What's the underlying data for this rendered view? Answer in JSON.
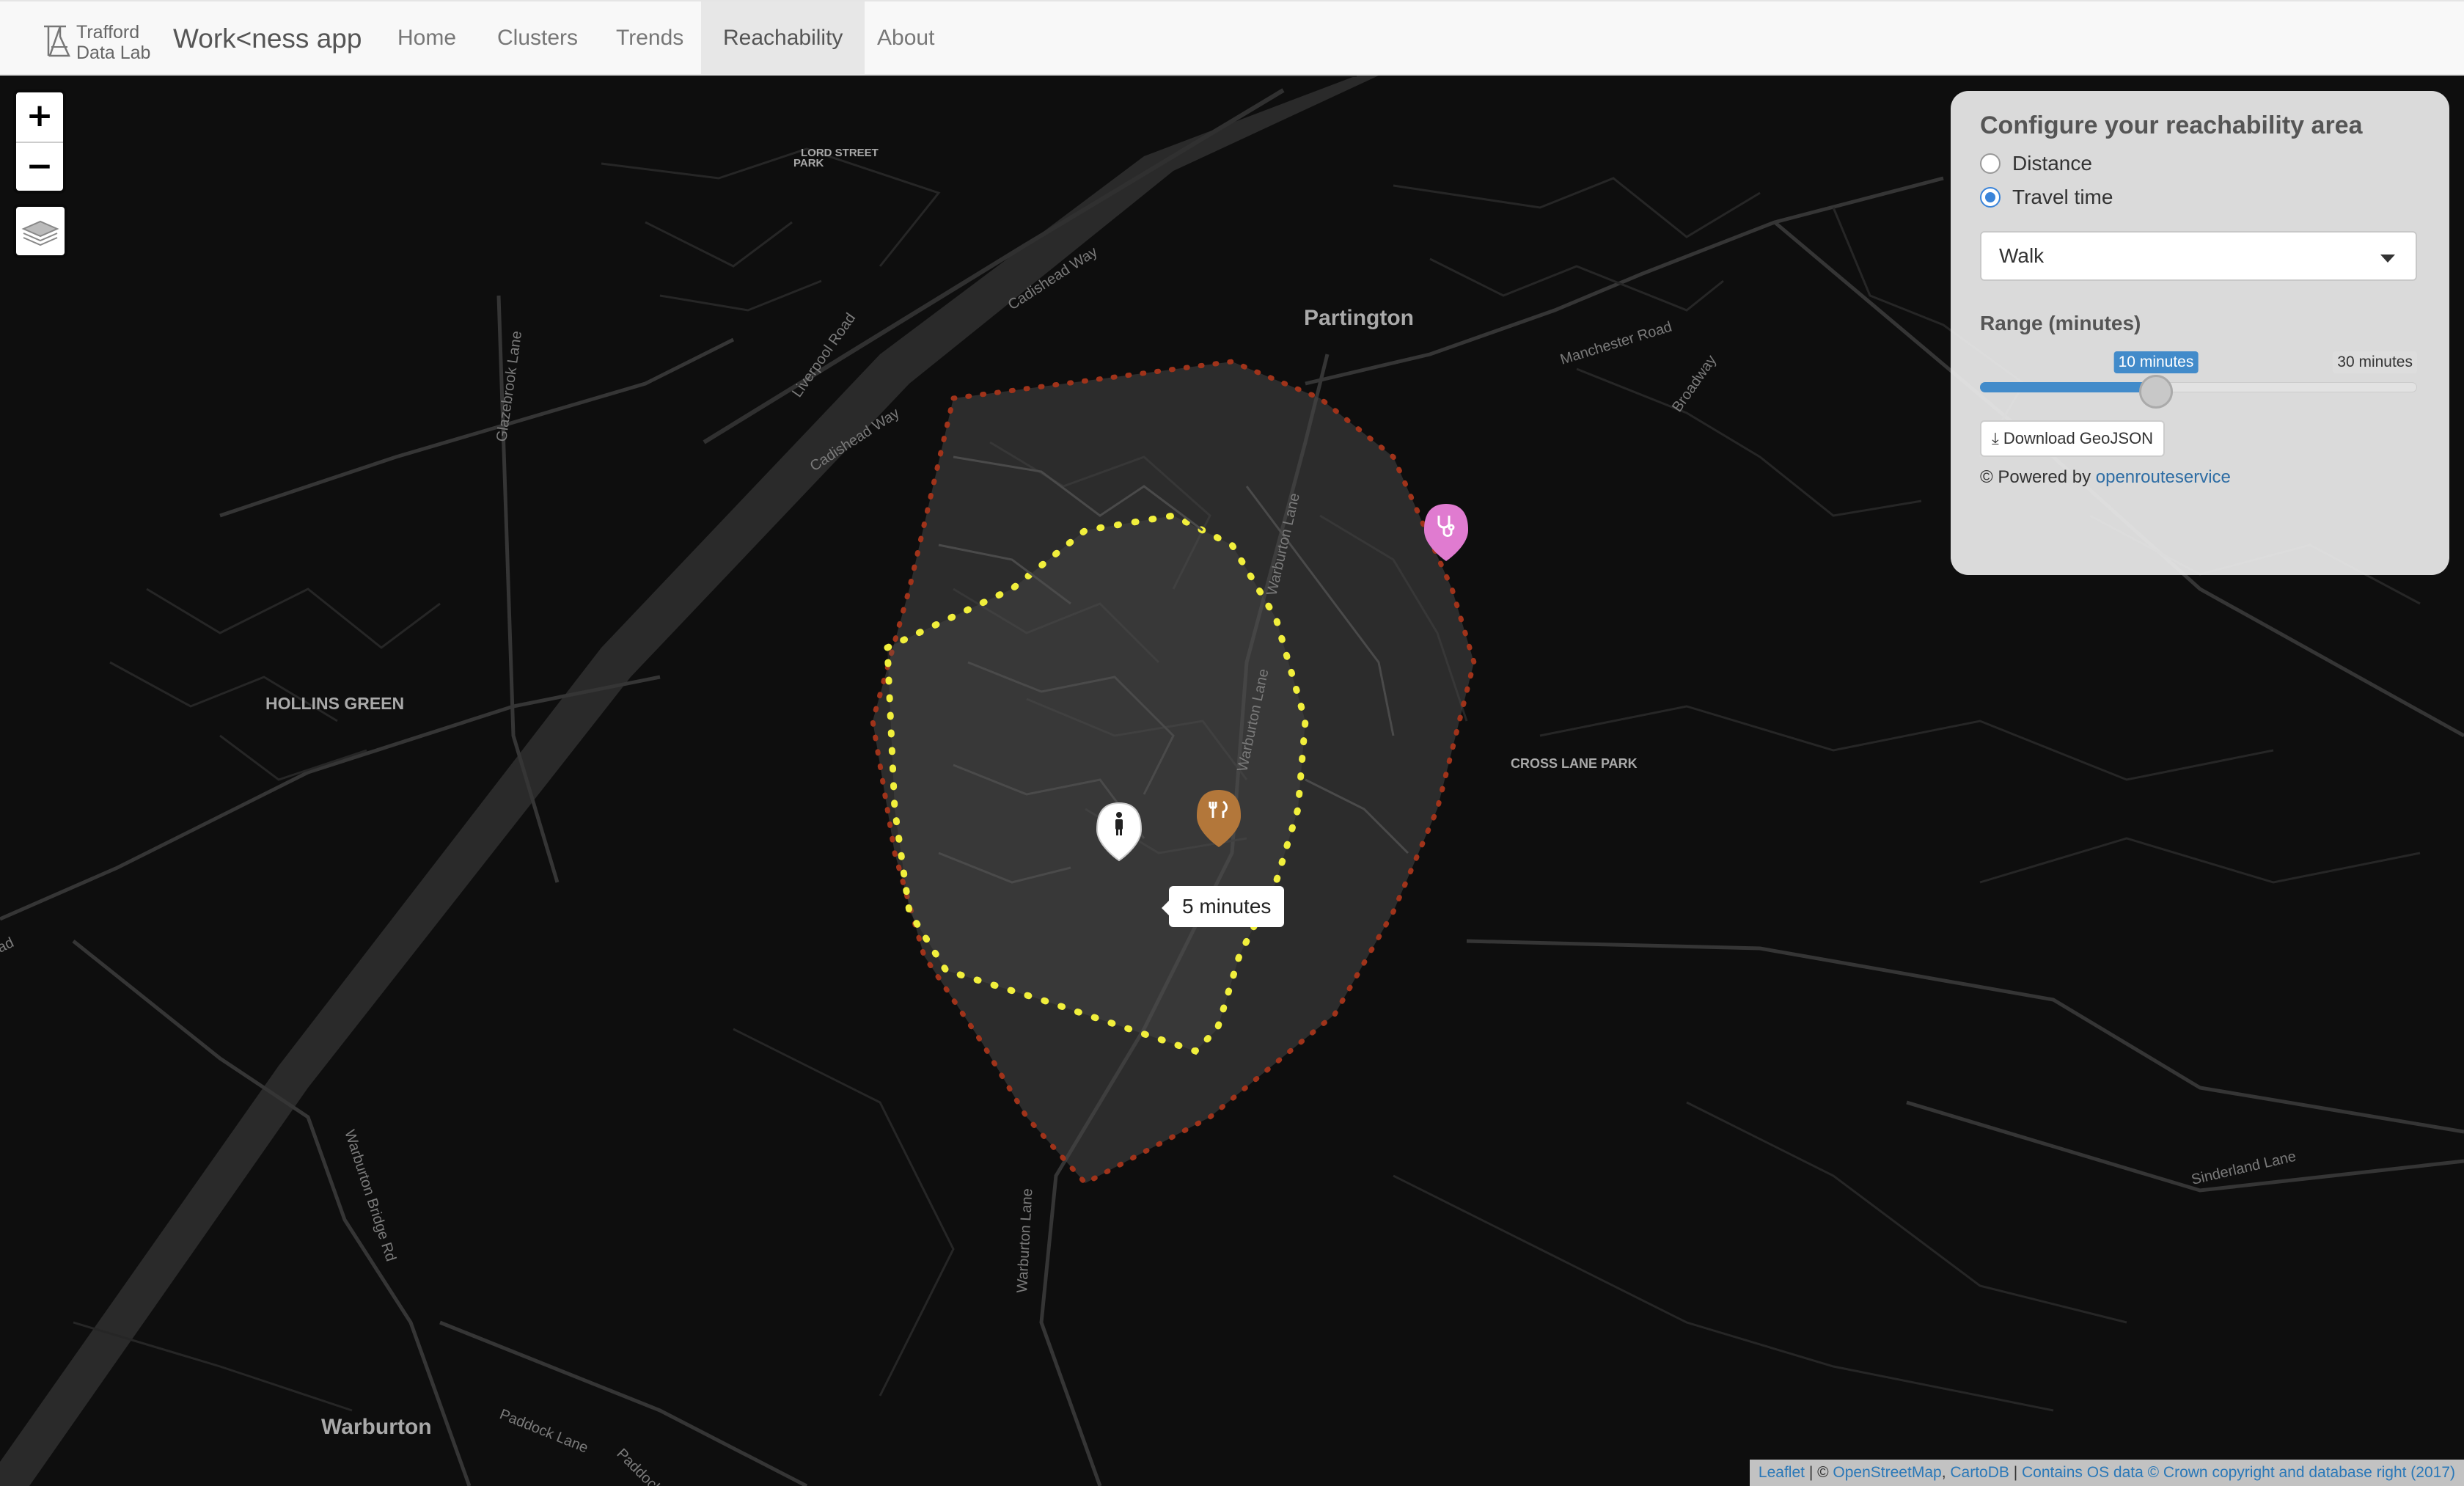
{
  "navbar": {
    "logo_line1": "Trafford",
    "logo_line2": "Data Lab",
    "app_title": "Work<ness app",
    "items": [
      {
        "label": "Home",
        "active": false
      },
      {
        "label": "Clusters",
        "active": false
      },
      {
        "label": "Trends",
        "active": false
      },
      {
        "label": "Reachability",
        "active": true
      },
      {
        "label": "About",
        "active": false
      }
    ]
  },
  "map_controls": {
    "zoom_in": "+",
    "zoom_out": "−",
    "layers_icon": "layers-icon"
  },
  "map": {
    "place_labels": {
      "partington": "Partington",
      "hollins_green": "HOLLINS GREEN",
      "cross_lane_park": "CROSS LANE PARK",
      "warburton": "Warburton",
      "lords_street_park_line1": "LORD STREET",
      "lords_street_park_line2": "PARK"
    },
    "road_labels": {
      "cadishead_way_1": "Cadishead Way",
      "cadishead_way_2": "Cadishead Way",
      "liverpool_road": "Liverpool Road",
      "glazebrook_lane": "Glazebrook Lane",
      "manchester_road": "Manchester Road",
      "broadway": "Broadway",
      "warburton_lane_1": "Warburton Lane",
      "warburton_lane_2": "Warburton Lane",
      "warburton_lane_3": "Warburton Lane",
      "warburton_bridge_rd": "Warburton Bridge Rd",
      "paddock_lane_1": "Paddock Lane",
      "paddock_lane_2": "Paddock Lane",
      "sinderland_lane": "Sinderland Lane",
      "west_road_fragment": "ad"
    },
    "isochrone_tooltip": "5 minutes",
    "colors": {
      "isochrone_10_border": "#a0331a",
      "isochrone_5_border": "#f1ef3c",
      "hospital_marker": "#e07bd0",
      "restaurant_marker": "#b3773a"
    },
    "markers": [
      {
        "name": "person-marker",
        "icon": "person-icon"
      },
      {
        "name": "restaurant-marker",
        "icon": "fork-knife-icon"
      },
      {
        "name": "medical-marker",
        "icon": "stethoscope-icon"
      }
    ]
  },
  "panel": {
    "title": "Configure your reachability area",
    "options": [
      {
        "label": "Distance",
        "checked": false
      },
      {
        "label": "Travel time",
        "checked": true
      }
    ],
    "mode_select": {
      "value": "Walk"
    },
    "range_label": "Range (minutes)",
    "slider": {
      "value": 10,
      "min": 5,
      "max": 30,
      "value_label": "10 minutes",
      "max_label": "30 minutes"
    },
    "download_button": "Download GeoJSON",
    "powered_by_prefix": "© Powered by",
    "powered_by_link": "openrouteservice"
  },
  "attribution": {
    "leaflet": "Leaflet",
    "sep1": " | © ",
    "osm": "OpenStreetMap",
    "comma": ", ",
    "carto": "CartoDB",
    "sep2": " | ",
    "os": "Contains OS data © Crown copyright and database right (2017)"
  }
}
